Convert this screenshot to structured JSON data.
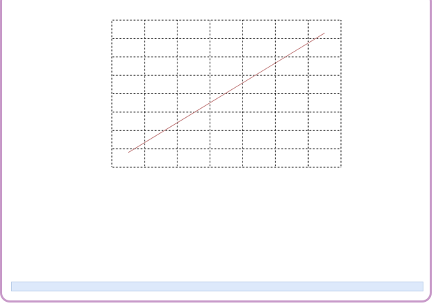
{
  "chart_data": {
    "type": "line",
    "title": "",
    "xlabel": "",
    "ylabel": "",
    "grid": true,
    "xlim": [
      0,
      7
    ],
    "ylim": [
      0,
      8
    ],
    "series": [
      {
        "color": "#c07a7a",
        "x": [
          0.5,
          6.5
        ],
        "y": [
          0.8,
          7.3
        ]
      }
    ]
  },
  "colors": {
    "frame": "#c89ac9",
    "status_bar": "#dde9fb"
  }
}
